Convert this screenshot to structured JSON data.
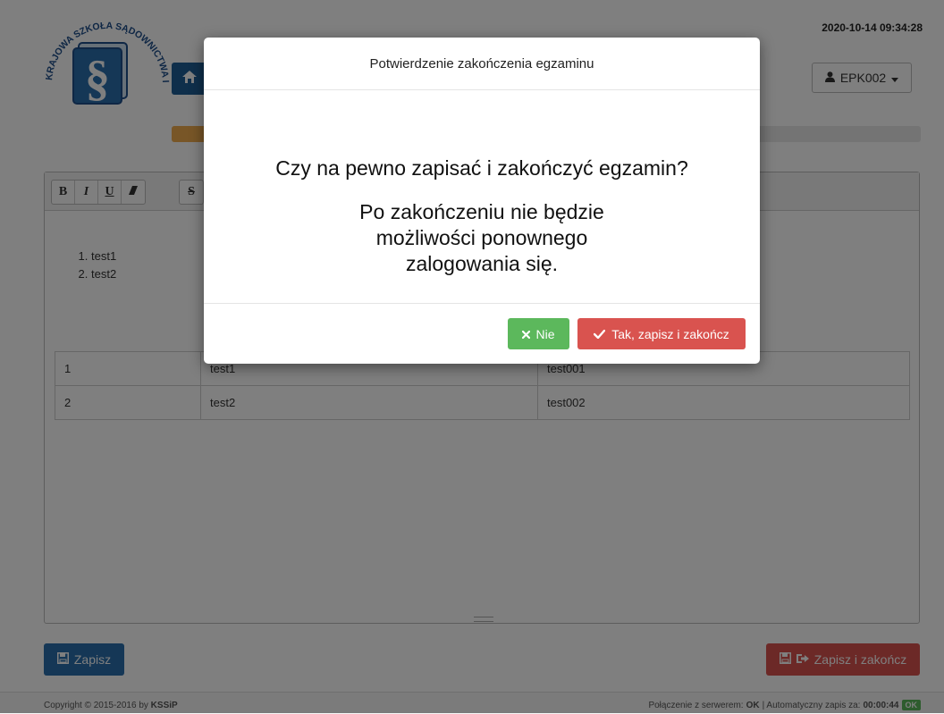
{
  "header": {
    "logo_text": "KRAJOWA SZKOŁA SĄDOWNICTWA I PROKURATURY",
    "datetime": "2020-10-14 09:34:28",
    "user": "EPK002",
    "progress_percent": 5
  },
  "editor": {
    "toolbar": [
      "B",
      "I",
      "U",
      "eraser",
      "S"
    ],
    "list_items": [
      "test1",
      "test2"
    ],
    "table": [
      [
        "1",
        "test1",
        "test001"
      ],
      [
        "2",
        "test2",
        "test002"
      ]
    ]
  },
  "actions": {
    "save_label": "Zapisz",
    "finish_label": "Zapisz i zakończ"
  },
  "footer": {
    "copyright": "Copyright © 2015-2016 by",
    "copyright_brand": "KSSiP",
    "connection_label": "Połączenie z serwerem:",
    "connection_status": "OK",
    "autosave_label": "| Automatyczny zapis za:",
    "autosave_time": "00:00:44",
    "ok_badge": "OK"
  },
  "modal": {
    "title": "Potwierdzenie zakończenia egzaminu",
    "question": "Czy na pewno zapisać i zakończyć egzamin?",
    "warning": "Po zakończeniu nie będzie możliwości ponownego zalogowania się.",
    "no_label": "Nie",
    "yes_label": "Tak, zapisz i zakończ"
  },
  "colors": {
    "primary": "#2a6fad",
    "danger": "#d9534f",
    "success": "#5cb85c",
    "warning": "#f0ad4e"
  }
}
